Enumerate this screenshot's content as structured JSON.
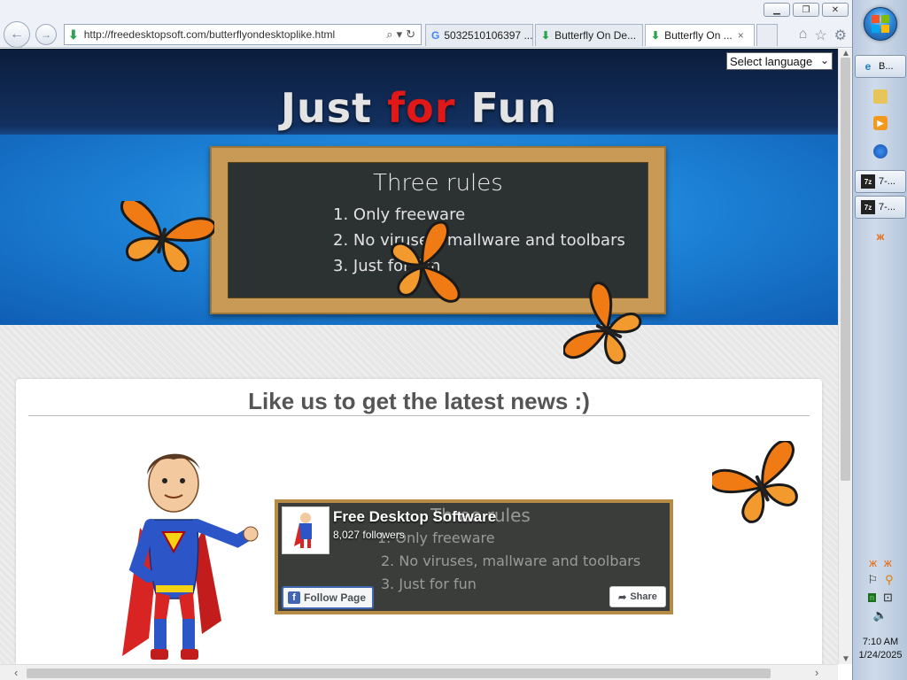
{
  "browser": {
    "address": "http://freedesktopsoft.com/butterflyondesktoplike.html",
    "tabs": [
      {
        "label": "5032510106397 ...",
        "icon": "google-icon"
      },
      {
        "label": "Butterfly On De...",
        "icon": "download-icon"
      },
      {
        "label": "Butterfly On ...",
        "icon": "download-icon",
        "active": true
      }
    ],
    "close_tab_label": "×"
  },
  "page": {
    "language_select": "Select language",
    "logo": {
      "word1": "Just",
      "word2": "for",
      "word3": "Fun"
    },
    "chalkboard": {
      "title": "Three rules",
      "rules": [
        "1. Only freeware",
        "2. No viruses, mallware and toolbars",
        "3. Just for fun"
      ]
    },
    "heading": "Like us to get the latest news :)",
    "facebook": {
      "page_name": "Free Desktop Software",
      "followers": "8,027 followers",
      "follow_label": "Follow Page",
      "share_label": "Share",
      "ghost_title": "Three rules",
      "ghost_rules": [
        "1. Only freeware",
        "2. No viruses, mallware and toolbars",
        "3. Just for fun"
      ]
    }
  },
  "taskbar": {
    "items": [
      {
        "label": "B...",
        "icon": "ie-icon"
      },
      {
        "label": "",
        "icon": "explorer-icon"
      },
      {
        "label": "",
        "icon": "media-player-icon"
      },
      {
        "label": "",
        "icon": "firefox-icon"
      },
      {
        "label": "7-...",
        "icon": "7zip-icon"
      },
      {
        "label": "7-...",
        "icon": "7zip-icon"
      },
      {
        "label": "",
        "icon": "butterfly-icon"
      }
    ],
    "clock_time": "7:10 AM",
    "clock_date": "1/24/2025"
  },
  "colors": {
    "logo_red": "#e01818",
    "facebook_blue": "#4267b2"
  }
}
